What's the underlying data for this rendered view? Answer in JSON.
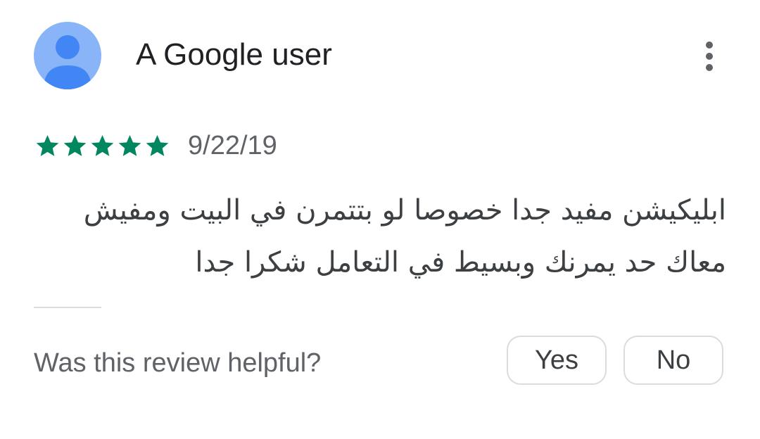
{
  "review": {
    "author": "A Google user",
    "rating": 5,
    "max_rating": 5,
    "date": "9/22/19",
    "text": "ابليكيشن مفيد جدا خصوصا لو بتتمرن في البيت ومفيش معاك حد يمرنك وبسيط في التعامل شكرا جدا",
    "avatar_icon": "person-icon",
    "more_icon": "more-vert-icon"
  },
  "helpful": {
    "question": "Was this review helpful?",
    "yes_label": "Yes",
    "no_label": "No"
  },
  "colors": {
    "star": "#01875f",
    "avatar_bg": "#8ab4f8",
    "avatar_fg": "#4285f4",
    "border": "#dadce0"
  }
}
